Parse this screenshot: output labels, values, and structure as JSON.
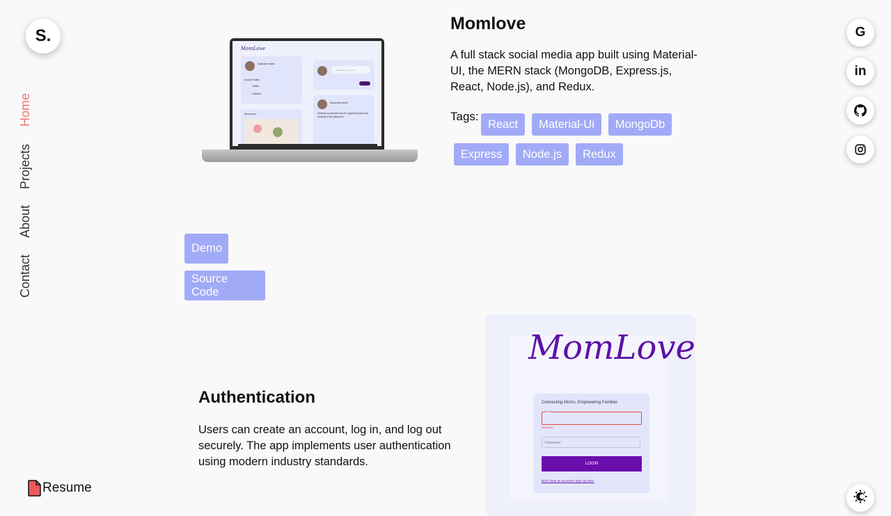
{
  "brand": {
    "logo": "S."
  },
  "nav": [
    {
      "label": "Home",
      "active": true
    },
    {
      "label": "Projects",
      "active": false
    },
    {
      "label": "About",
      "active": false
    },
    {
      "label": "Contact",
      "active": false
    }
  ],
  "social": [
    {
      "icon": "google-icon"
    },
    {
      "icon": "linkedin-icon"
    },
    {
      "icon": "github-icon"
    },
    {
      "icon": "instagram-icon"
    }
  ],
  "resume": {
    "label": "Resume",
    "icon": "document-icon"
  },
  "theme_toggle": {
    "icon": "theme-toggle-icon"
  },
  "project": {
    "title": "Momlove",
    "description": "A full stack social media app built using Material-UI, the MERN stack (MongoDB, Express.js, React, Node.js), and Redux.",
    "tags_label": "Tags:",
    "tags": [
      "React",
      "Material-Ui",
      "MongoDb",
      "Express",
      "Node.js",
      "Redux"
    ],
    "demo_label": "Demo",
    "source_label": "Source Code"
  },
  "laptop_screen": {
    "app_logo": "MomLove",
    "user_name": "Nathalie lewis",
    "social_profile": "Social Profiles",
    "twitter": "Twitter",
    "linkedin": "Linkedin",
    "sponsored": "Sponsored",
    "post_placeholder": "What's on your mind...",
    "post_user": "Samantha Smith",
    "post_text": "Sharing my favorite tips for organizing toys and keeping a tidy playroom!"
  },
  "auth": {
    "title": "Authentication",
    "description": "Users can create an account, log in, and log out securely. The app implements user authentication using modern industry standards."
  },
  "login_preview": {
    "brand": "MomLove",
    "heading": "Connecting Moms, Empowering Families",
    "email_label": "Email",
    "required": "Required",
    "password_placeholder": "Password",
    "login_button": "LOGIN",
    "signup_link": "Don't have an account? Sign Up here."
  },
  "colors": {
    "accent": "#a1aaf7",
    "active_nav": "#f07373",
    "brand_purple": "#5e12a5"
  }
}
